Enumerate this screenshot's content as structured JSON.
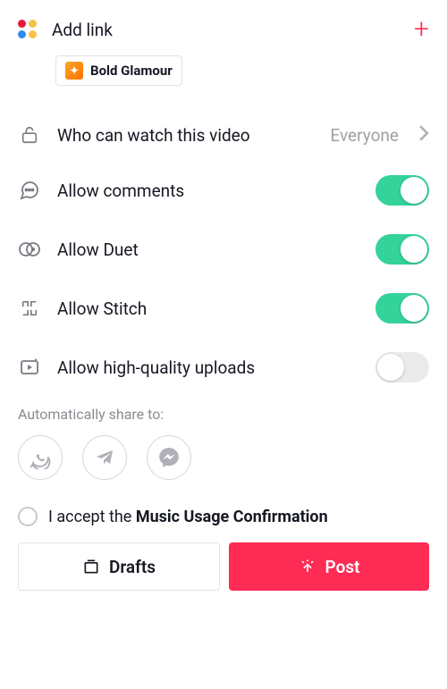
{
  "header": {
    "add_link_label": "Add link"
  },
  "effect": {
    "name": "Bold Glamour"
  },
  "settings": {
    "privacy": {
      "label": "Who can watch this video",
      "value": "Everyone"
    },
    "comments": {
      "label": "Allow comments",
      "enabled": true
    },
    "duet": {
      "label": "Allow Duet",
      "enabled": true
    },
    "stitch": {
      "label": "Allow Stitch",
      "enabled": true
    },
    "hq": {
      "label": "Allow high-quality uploads",
      "enabled": false
    }
  },
  "share": {
    "label": "Automatically share to:",
    "targets": [
      "whatsapp",
      "telegram",
      "messenger"
    ]
  },
  "accept": {
    "prefix": "I accept the ",
    "bold": "Music Usage Confirmation",
    "checked": false
  },
  "buttons": {
    "drafts": "Drafts",
    "post": "Post"
  }
}
